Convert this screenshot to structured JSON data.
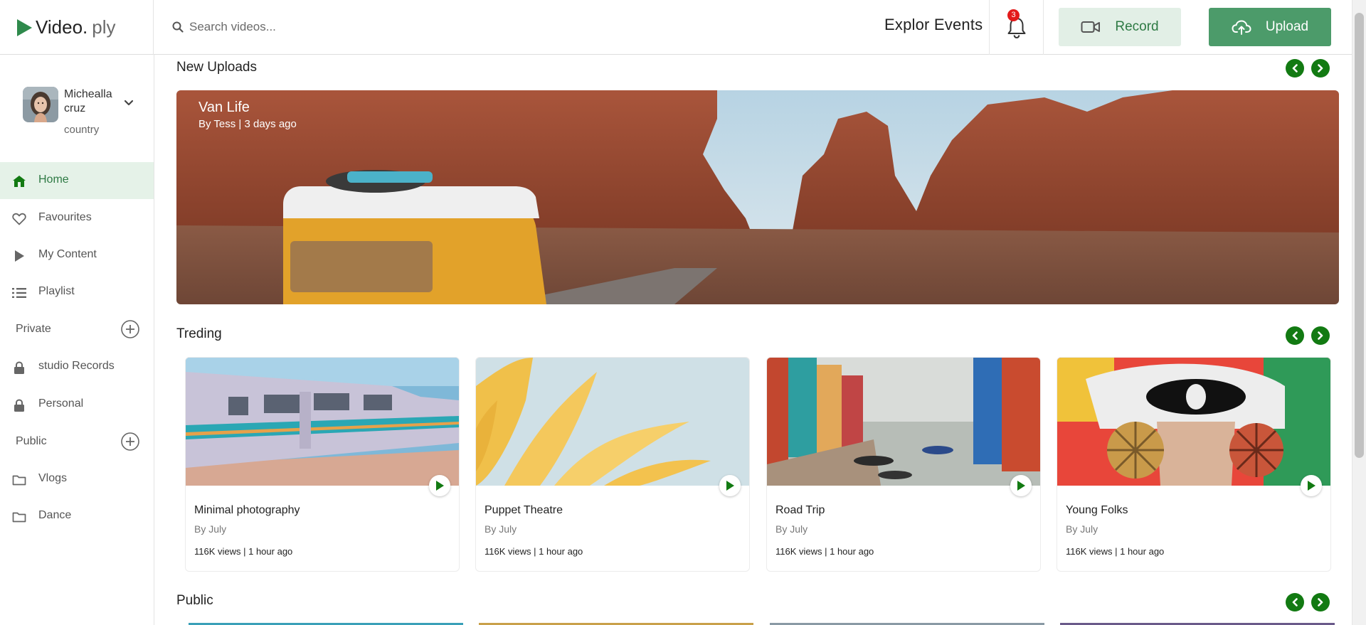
{
  "brand": {
    "name": "Video.",
    "suffix": "ply",
    "color": "#2f8a4c"
  },
  "search": {
    "placeholder": "Search videos..."
  },
  "header": {
    "explore_label": "Explor Events",
    "notification_count": "3",
    "record_label": "Record",
    "upload_label": "Upload"
  },
  "profile": {
    "name": "Michealla cruz",
    "subtitle": "country"
  },
  "sidebar": {
    "items": [
      {
        "label": "Home",
        "icon": "home-icon",
        "active": true
      },
      {
        "label": "Favourites",
        "icon": "heart-icon"
      },
      {
        "label": "My Content",
        "icon": "play-icon"
      },
      {
        "label": "Playlist",
        "icon": "list-icon"
      }
    ],
    "private_label": "Private",
    "private_items": [
      {
        "label": "studio Records",
        "icon": "lock-icon"
      },
      {
        "label": "Personal",
        "icon": "lock-icon"
      }
    ],
    "public_label": "Public",
    "public_items": [
      {
        "label": "Vlogs",
        "icon": "folder-icon"
      },
      {
        "label": "Dance",
        "icon": "folder-icon"
      }
    ]
  },
  "sections": {
    "new_uploads": "New Uploads",
    "trending": "Treding",
    "public": "Public"
  },
  "hero": {
    "title": "Van Life",
    "meta": "By Tess | 3 days ago"
  },
  "trending_cards": [
    {
      "title": "Minimal photography",
      "author": "By July",
      "stats": "116K views | 1 hour ago"
    },
    {
      "title": "Puppet Theatre",
      "author": "By July",
      "stats": "116K views | 1 hour ago"
    },
    {
      "title": "Road Trip",
      "author": "By July",
      "stats": "116K views | 1 hour ago"
    },
    {
      "title": "Young Folks",
      "author": "By July",
      "stats": "116K views | 1 hour ago"
    }
  ],
  "colors": {
    "accent": "#127a12",
    "active_bg": "#e5f2e8",
    "upload_bg": "#4c9b6a",
    "record_bg": "#e2efe6",
    "badge": "#e31b1b"
  }
}
